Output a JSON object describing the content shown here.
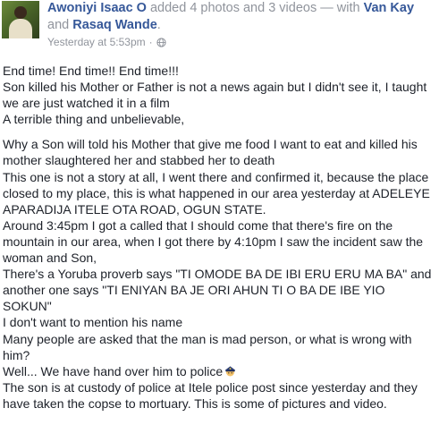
{
  "header": {
    "author": "Awoniyi Isaac O",
    "added_text": " added 4 photos and 3 videos — with ",
    "tag1": "Van Kay",
    "and_text": " and ",
    "tag2": "Rasaq Wande",
    "end_text": ".",
    "timestamp": "Yesterday at 5:53pm",
    "separator": "·",
    "audience_icon": "globe-icon"
  },
  "post": {
    "lines": [
      "End time! End time!! End time!!!",
      "Son killed his Mother or Father is not a news again but I didn't see it, I taught we are just watched it in a film",
      "A terrible thing and unbelievable,",
      "",
      "Why a Son will told his Mother that give me food I want to eat and killed his mother slaughtered her and stabbed her to death",
      "This one is not a story at all, I went there and confirmed it, because the place closed to my place, this is what happened in our area yesterday at ADELEYE APARADIJA ITELE OTA ROAD, OGUN STATE.",
      "Around 3:45pm I got a called that I should come that there's fire on the mountain in our area, when I got there by 4:10pm I saw the incident saw the woman and Son,",
      "There's a Yoruba proverb says \"TI OMODE BA DE IBI ERU ERU MA BA\" and another one says \"TI ENIYAN BA JE ORI AHUN TI O BA DE IBE YIO SOKUN\"",
      "I don't want to mention his name",
      "Many people are asked that the man is mad person, or what is wrong with him?",
      "Well... We have hand over him to police",
      "The son is at custody of police at Itele police post since yesterday and they have taken the copse to mortuary. This is some of pictures and video."
    ],
    "police_emoji": "police-officer-icon"
  }
}
